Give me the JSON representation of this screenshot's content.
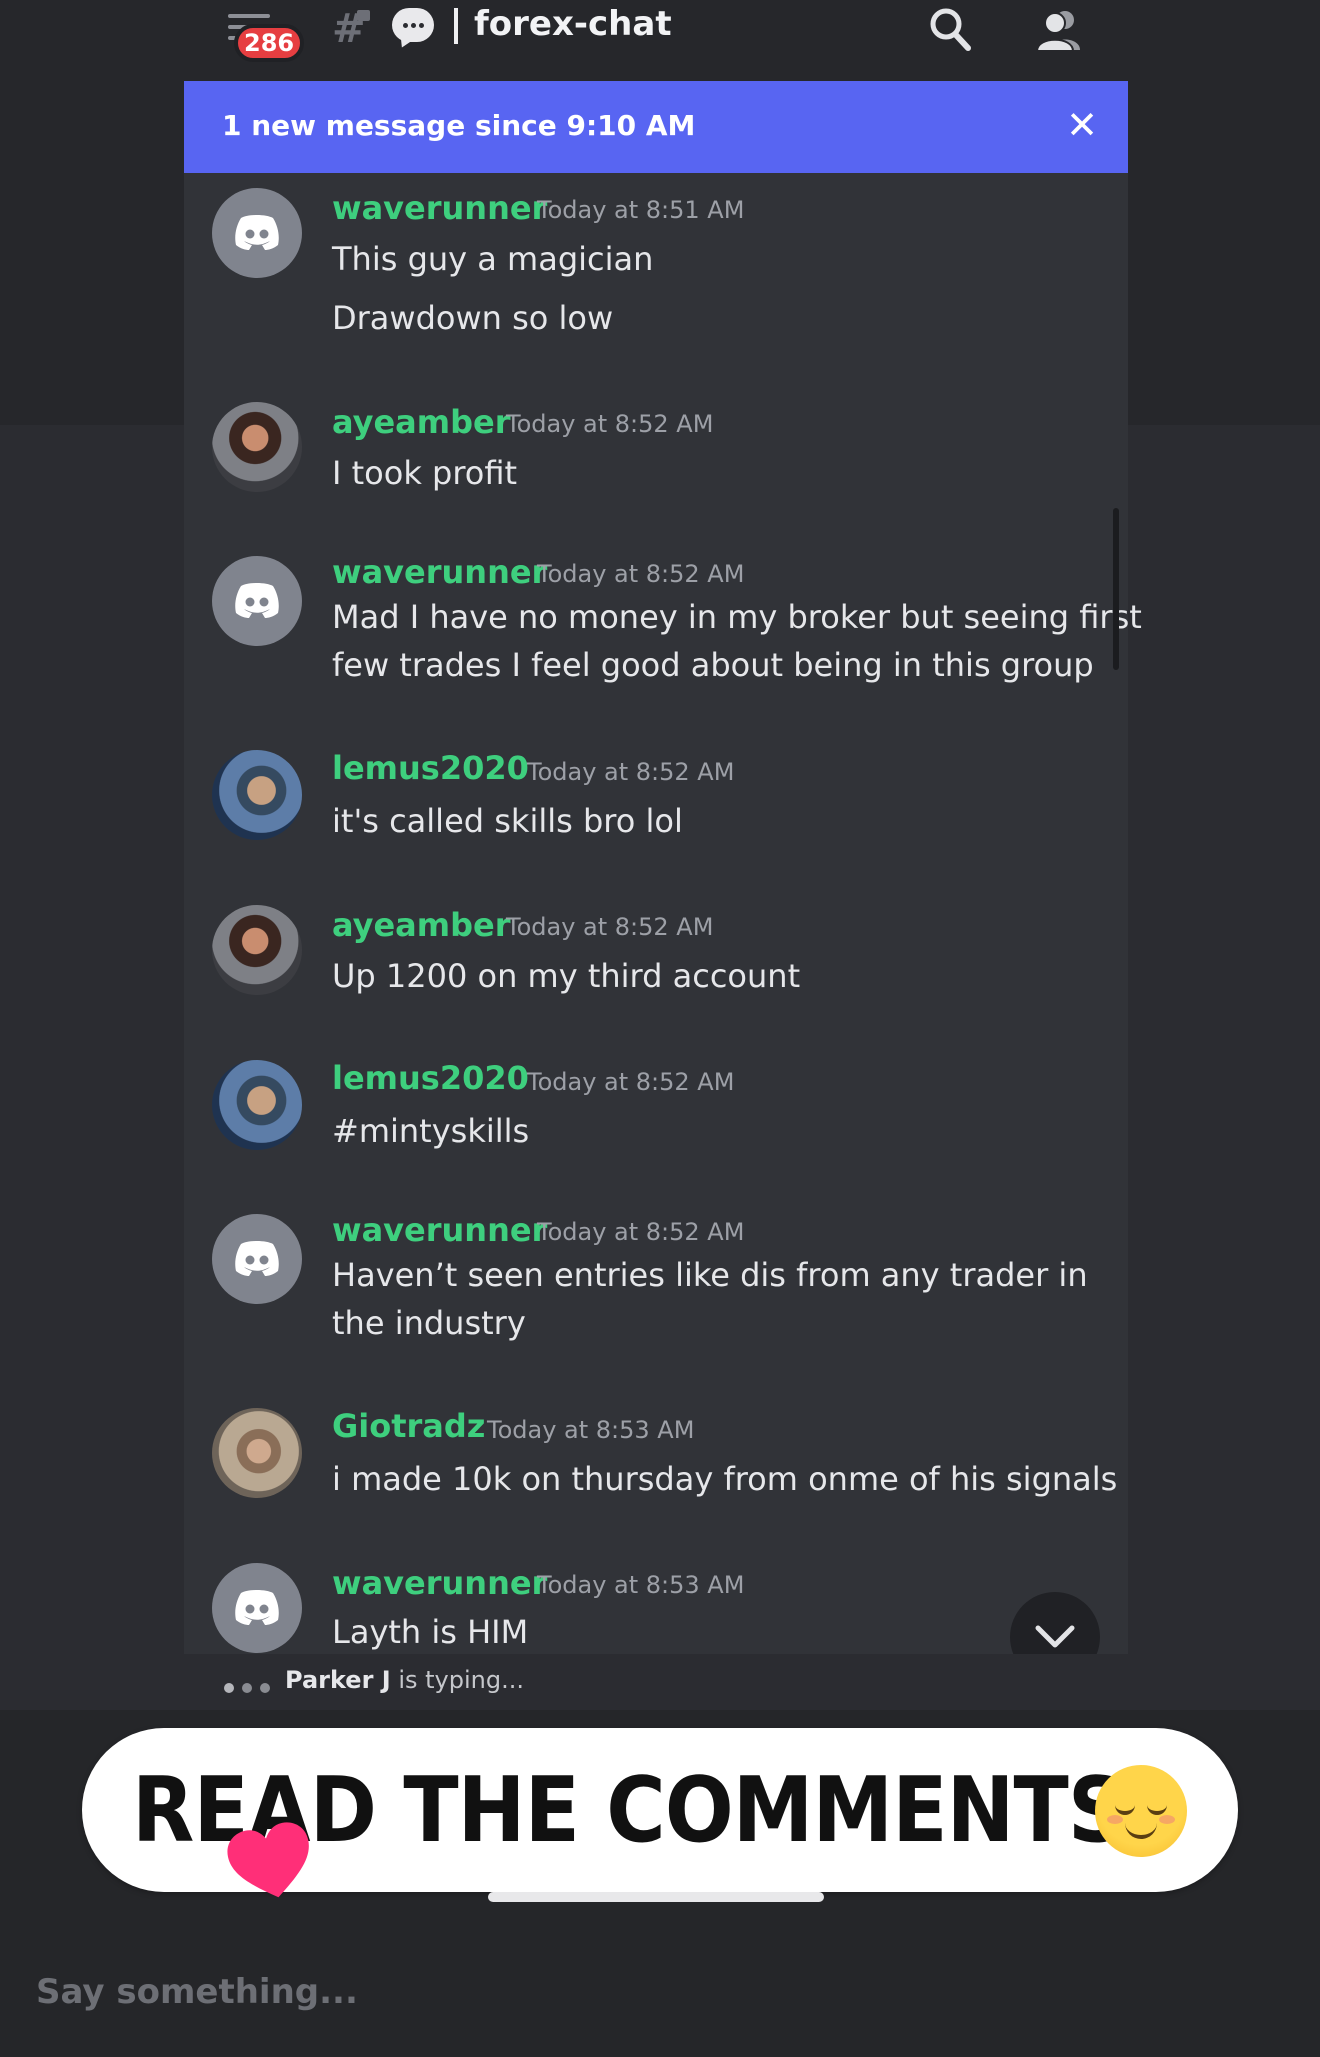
{
  "header": {
    "unread_badge": "286",
    "channel_name": "forex-chat",
    "icons": [
      "hamburger-menu-icon",
      "locked-hash-icon",
      "threads-icon",
      "search-icon",
      "members-icon"
    ]
  },
  "banner": {
    "text": "1 new message since 9:10 AM",
    "close": "✕"
  },
  "messages": [
    {
      "user": "waverunner",
      "time": "Today at 8:51 AM",
      "lines": [
        "This guy a magician",
        "Drawdown so low"
      ]
    },
    {
      "user": "ayeamber",
      "time": "Today at 8:52 AM",
      "lines": [
        "I took profit"
      ]
    },
    {
      "user": "waverunner",
      "time": "Today at 8:52 AM",
      "lines": [
        "Mad I have no money in my broker but seeing first",
        "few trades I feel good about being in this group"
      ]
    },
    {
      "user": "lemus2020",
      "time": "Today at 8:52 AM",
      "lines": [
        "it's called skills bro lol"
      ]
    },
    {
      "user": "ayeamber",
      "time": "Today at 8:52 AM",
      "lines": [
        "Up 1200 on my third account"
      ]
    },
    {
      "user": "lemus2020",
      "time": "Today at 8:52 AM",
      "lines": [
        "#mintyskills"
      ]
    },
    {
      "user": "waverunner",
      "time": "Today at 8:52 AM",
      "lines": [
        "Haven’t seen entries like dis from any trader in",
        "the industry"
      ]
    },
    {
      "user": "Giotradz",
      "time": "Today at 8:53 AM",
      "lines": [
        "i made 10k on thursday from onme of his signals"
      ]
    },
    {
      "user": "waverunner",
      "time": "Today at 8:53 AM",
      "lines": [
        "Layth is HIM"
      ]
    }
  ],
  "typing": {
    "name": "Parker J",
    "suffix": " is typing..."
  },
  "story": {
    "caption": "READ THE COMMENTS",
    "emoji": "relieved-face-emoji",
    "reaction": "heart-icon",
    "reply_placeholder": "Say something..."
  },
  "colors": {
    "banner": "#5865f2",
    "username": "#3ecf7e",
    "badge": "#e63e41",
    "panel": "#313338"
  }
}
